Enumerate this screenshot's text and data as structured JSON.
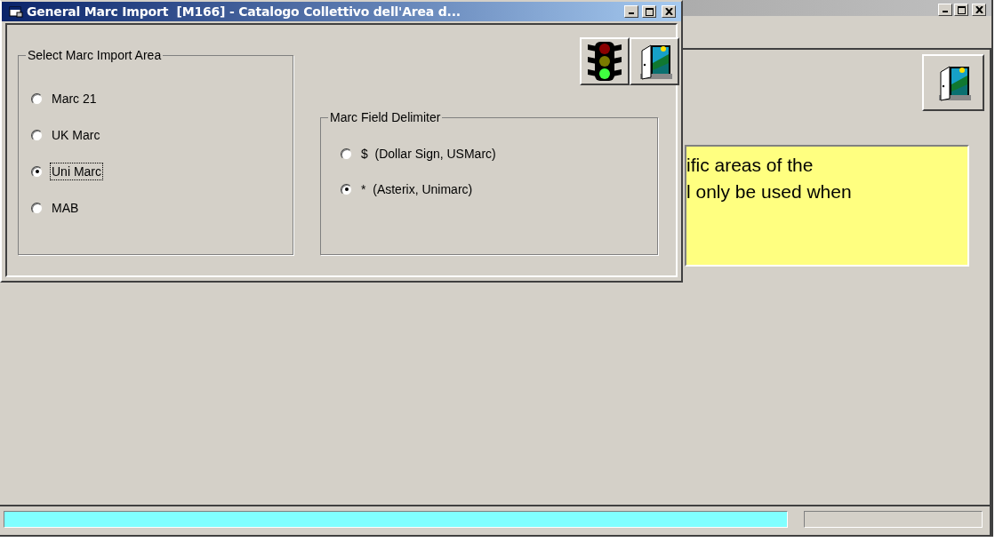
{
  "main_window": {
    "info_lines": [
      "ific areas of the",
      "l only be used when"
    ]
  },
  "dialog": {
    "title": "General Marc Import  [M166] - Catalogo Collettivo dell'Area d...",
    "import_area": {
      "label": "Select Marc Import Area",
      "options": [
        {
          "label": "Marc 21",
          "selected": false,
          "focused": false
        },
        {
          "label": "UK Marc",
          "selected": false,
          "focused": false
        },
        {
          "label": "Uni Marc",
          "selected": true,
          "focused": true
        },
        {
          "label": "MAB",
          "selected": false,
          "focused": false
        }
      ]
    },
    "field_delimiter": {
      "label": "Marc Field Delimiter",
      "options": [
        {
          "label": "$  (Dollar Sign, USMarc)",
          "selected": false,
          "focused": false
        },
        {
          "label": "*  (Asterix, Unimarc)",
          "selected": true,
          "focused": false
        }
      ]
    }
  }
}
